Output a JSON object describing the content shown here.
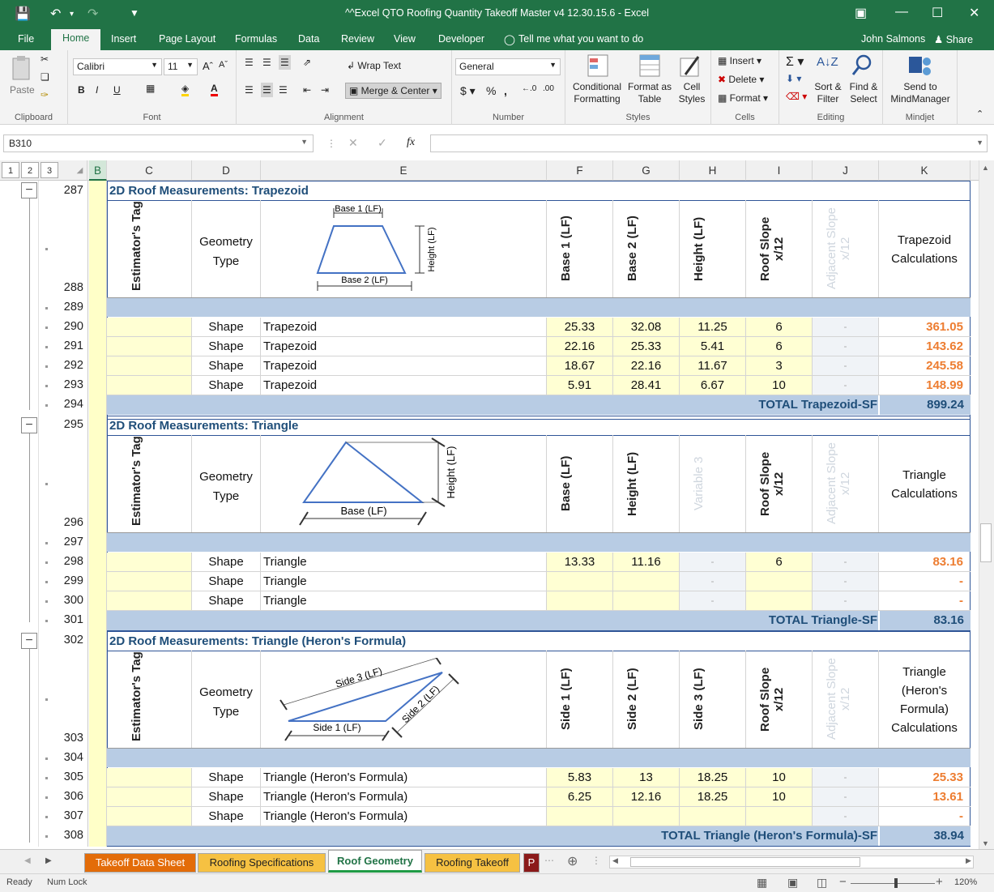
{
  "window": {
    "title": "^^Excel QTO Roofing Quantity Takeoff Master v4 12.30.15.6 - Excel"
  },
  "tabs": [
    "File",
    "Home",
    "Insert",
    "Page Layout",
    "Formulas",
    "Data",
    "Review",
    "View",
    "Developer"
  ],
  "tell_me": "Tell me what you want to do",
  "user": "John Salmons",
  "share": "Share",
  "ribbon": {
    "paste": "Paste",
    "font_name": "Calibri",
    "font_size": "11",
    "wrap_text": "Wrap Text",
    "merge_center": "Merge & Center",
    "number_format": "General",
    "cond_format": [
      "Conditional",
      "Formatting"
    ],
    "format_table": [
      "Format as",
      "Table"
    ],
    "cell_styles": [
      "Cell",
      "Styles"
    ],
    "insert": "Insert",
    "delete": "Delete",
    "format": "Format",
    "sort_filter": [
      "Sort &",
      "Filter"
    ],
    "find_select": [
      "Find &",
      "Select"
    ],
    "send_to": [
      "Send to",
      "MindManager"
    ],
    "groups": [
      "Clipboard",
      "Font",
      "Alignment",
      "Number",
      "Styles",
      "Cells",
      "Editing",
      "Mindjet"
    ]
  },
  "namebox": "B310",
  "fx": "fx",
  "outline_levels": [
    "1",
    "2",
    "3"
  ],
  "columns": [
    "B",
    "C",
    "D",
    "E",
    "F",
    "G",
    "H",
    "I",
    "J",
    "K"
  ],
  "rows": [
    "287",
    "288",
    "289",
    "290",
    "291",
    "292",
    "293",
    "294",
    "295",
    "296",
    "297",
    "298",
    "299",
    "300",
    "301",
    "302",
    "303",
    "304",
    "305",
    "306",
    "307",
    "308"
  ],
  "trapezoid": {
    "title": "2D Roof Measurements: Trapezoid",
    "headers": {
      "tag": "Estimator's Tag",
      "geo1": "Geometry",
      "geo2": "Type",
      "f": "Base 1 (LF)",
      "g": "Base 2 (LF)",
      "h": "Height (LF)",
      "i": "Roof Slope x/12",
      "j": "Adjacent Slope x/12",
      "k1": "Trapezoid",
      "k2": "Calculations"
    },
    "diagram": {
      "top": "Base 1 (LF)",
      "bottom": "Base 2 (LF)",
      "side": "Height (LF)"
    },
    "data": [
      {
        "d": "Shape",
        "e": "Trapezoid",
        "f": "25.33",
        "g": "32.08",
        "h": "11.25",
        "i": "6",
        "j": "-",
        "k": "361.05"
      },
      {
        "d": "Shape",
        "e": "Trapezoid",
        "f": "22.16",
        "g": "25.33",
        "h": "5.41",
        "i": "6",
        "j": "-",
        "k": "143.62"
      },
      {
        "d": "Shape",
        "e": "Trapezoid",
        "f": "18.67",
        "g": "22.16",
        "h": "11.67",
        "i": "3",
        "j": "-",
        "k": "245.58"
      },
      {
        "d": "Shape",
        "e": "Trapezoid",
        "f": "5.91",
        "g": "28.41",
        "h": "6.67",
        "i": "10",
        "j": "-",
        "k": "148.99"
      }
    ],
    "total_label": "TOTAL Trapezoid-SF",
    "total": "899.24"
  },
  "triangle": {
    "title": "2D Roof Measurements: Triangle",
    "headers": {
      "tag": "Estimator's Tag",
      "geo1": "Geometry",
      "geo2": "Type",
      "f": "Base (LF)",
      "g": "Height (LF)",
      "h": "Variable 3",
      "i": "Roof Slope x/12",
      "j": "Adjacent Slope x/12",
      "k1": "Triangle",
      "k2": "Calculations"
    },
    "diagram": {
      "bottom": "Base (LF)",
      "side": "Height (LF)"
    },
    "data": [
      {
        "d": "Shape",
        "e": "Triangle",
        "f": "13.33",
        "g": "11.16",
        "h": "-",
        "i": "6",
        "j": "-",
        "k": "83.16"
      },
      {
        "d": "Shape",
        "e": "Triangle",
        "f": "",
        "g": "",
        "h": "-",
        "i": "",
        "j": "-",
        "k": "-"
      },
      {
        "d": "Shape",
        "e": "Triangle",
        "f": "",
        "g": "",
        "h": "-",
        "i": "",
        "j": "-",
        "k": "-"
      }
    ],
    "total_label": "TOTAL Triangle-SF",
    "total": "83.16"
  },
  "heron": {
    "title": "2D Roof Measurements: Triangle (Heron's Formula)",
    "headers": {
      "tag": "Estimator's Tag",
      "geo1": "Geometry",
      "geo2": "Type",
      "f": "Side 1 (LF)",
      "g": "Side 2 (LF)",
      "h": "Side 3 (LF)",
      "i": "Roof Slope x/12",
      "j": "Adjacent Slope x/12",
      "k1": "Triangle",
      "k2": "(Heron's",
      "k3": "Formula)",
      "k4": "Calculations"
    },
    "diagram": {
      "s1": "Side 1 (LF)",
      "s2": "Side 2 (LF)",
      "s3": "Side 3 (LF)"
    },
    "data": [
      {
        "d": "Shape",
        "e": "Triangle (Heron's Formula)",
        "f": "5.83",
        "g": "13",
        "h": "18.25",
        "i": "10",
        "j": "-",
        "k": "25.33"
      },
      {
        "d": "Shape",
        "e": "Triangle (Heron's Formula)",
        "f": "6.25",
        "g": "12.16",
        "h": "18.25",
        "i": "10",
        "j": "-",
        "k": "13.61"
      },
      {
        "d": "Shape",
        "e": "Triangle (Heron's Formula)",
        "f": "",
        "g": "",
        "h": "",
        "i": "",
        "j": "-",
        "k": "-"
      }
    ],
    "total_label": "TOTAL Triangle (Heron's Formula)-SF",
    "total": "38.94"
  },
  "sheets": [
    "Takeoff Data Sheet",
    "Roofing Specifications",
    "Roof Geometry",
    "Roofing Takeoff",
    "P"
  ],
  "status": {
    "ready": "Ready",
    "numlock": "Num Lock",
    "zoom": "120%"
  }
}
